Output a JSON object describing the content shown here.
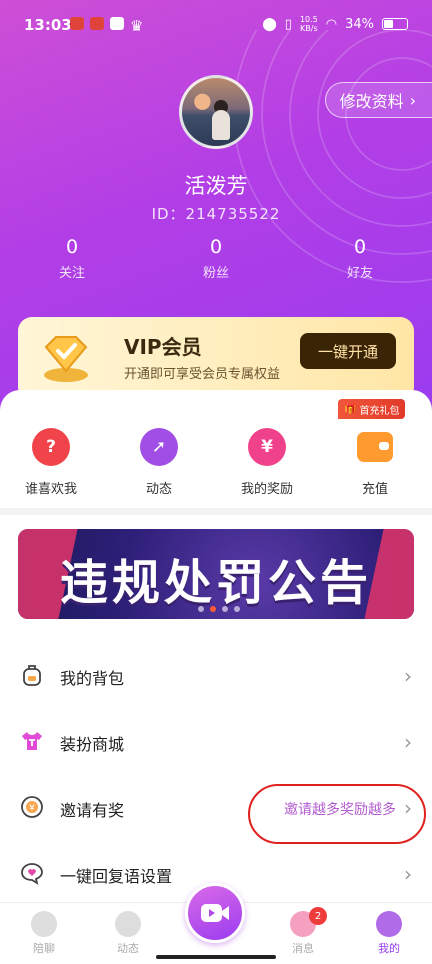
{
  "status": {
    "time": "13:03",
    "net_speed": "10.5\nKB/s",
    "battery": "34%"
  },
  "profile": {
    "edit_label": "修改资料",
    "nickname": "活泼芳",
    "id_text": "ID：214735522",
    "stats": [
      {
        "value": "0",
        "label": "关注"
      },
      {
        "value": "0",
        "label": "粉丝"
      },
      {
        "value": "0",
        "label": "好友"
      }
    ]
  },
  "vip": {
    "title": "VIP会员",
    "subtitle": "开通即可享受会员专属权益",
    "button": "一键开通"
  },
  "quick": {
    "gift_tag": "首充礼包",
    "items": [
      {
        "label": "谁喜欢我",
        "icon": "heart-question-icon",
        "color": "#f0434a"
      },
      {
        "label": "动态",
        "icon": "compass-icon",
        "color": "#a04ee6"
      },
      {
        "label": "我的奖励",
        "icon": "money-bag-icon",
        "color": "#f0428a"
      },
      {
        "label": "充值",
        "icon": "wallet-icon",
        "color": "#ff9a2e"
      }
    ]
  },
  "banner": {
    "text": "违规处罚公告",
    "dots": 4,
    "active_dot": 1
  },
  "menu": [
    {
      "label": "我的背包",
      "icon": "backpack-icon"
    },
    {
      "label": "装扮商城",
      "icon": "tshirt-icon"
    },
    {
      "label": "邀请有奖",
      "icon": "coin-icon",
      "hint": "邀请越多奖励越多"
    },
    {
      "label": "一键回复语设置",
      "icon": "chat-heart-icon"
    }
  ],
  "tabbar": {
    "items": [
      {
        "label": "陪聊"
      },
      {
        "label": "动态"
      },
      {
        "label": "消息",
        "badge": "2"
      },
      {
        "label": "我的"
      }
    ]
  }
}
